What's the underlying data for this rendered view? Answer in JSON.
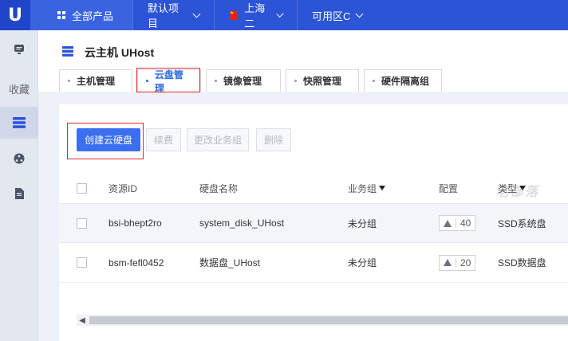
{
  "topbar": {
    "logo": "U",
    "all_products": "全部产品",
    "project": "默认项目",
    "region": "上海二",
    "zone": "可用区C"
  },
  "sidebar": {
    "favorites_label": "收藏"
  },
  "page": {
    "title": "云主机 UHost",
    "tabs": [
      "主机管理",
      "云盘管理",
      "镜像管理",
      "快照管理",
      "硬件隔离组"
    ],
    "active_tab": "云盘管理"
  },
  "toolbar": {
    "create_label": "创建云硬盘",
    "renew_label": "续费",
    "change_group_label": "更改业务组",
    "delete_label": "删除"
  },
  "table": {
    "headers": {
      "resource_id": "资源ID",
      "disk_name": "硬盘名称",
      "business_group": "业务组",
      "config": "配置",
      "type": "类型"
    },
    "rows": [
      {
        "resource_id": "bsi-bhept2ro",
        "disk_name": "system_disk_UHost",
        "business_group": "未分组",
        "config": "40",
        "type": "SSD系统盘"
      },
      {
        "resource_id": "bsm-fefl0452",
        "disk_name": "数据盘_UHost",
        "business_group": "未分组",
        "config": "20",
        "type": "SSD数据盘"
      }
    ]
  },
  "watermark": "老部落",
  "colors": {
    "brand": "#2b54d6",
    "primary_button": "#3b6ef0",
    "highlight": "#e32a2a",
    "active_tab": "#2b6ae0"
  }
}
